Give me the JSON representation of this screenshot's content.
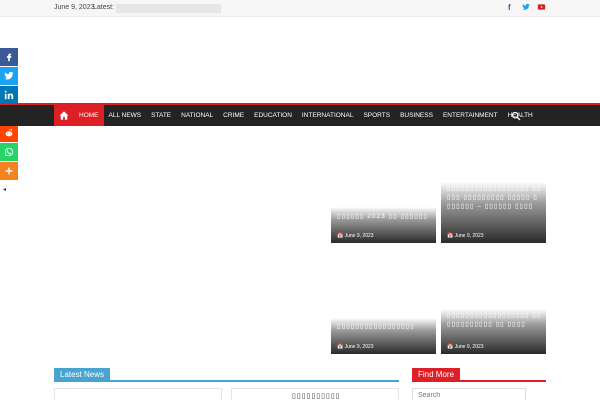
{
  "topbar": {
    "date": "June 9, 2023",
    "latest_label": "Latest:",
    "social": [
      {
        "name": "facebook-icon",
        "glyph": "f",
        "color": "#3b5998"
      },
      {
        "name": "twitter-icon",
        "glyph": "t",
        "color": "#1da1f2"
      },
      {
        "name": "youtube-icon",
        "glyph": "▶",
        "color": "#cd201f"
      }
    ]
  },
  "share": {
    "buttons": [
      {
        "name": "facebook-share-icon",
        "color": "#3b5998"
      },
      {
        "name": "twitter-share-icon",
        "color": "#1da1f2"
      },
      {
        "name": "linkedin-share-icon",
        "color": "#0077b5"
      },
      {
        "name": "pinterest-share-icon",
        "color": "#cb2027"
      },
      {
        "name": "reddit-share-icon",
        "color": "#ff4500"
      },
      {
        "name": "whatsapp-share-icon",
        "color": "#25d366"
      },
      {
        "name": "more-share-icon",
        "color": "#f58220"
      }
    ],
    "hide_label": "◂"
  },
  "nav": {
    "items": [
      "HOME",
      "ALL NEWS",
      "STATE",
      "NATIONAL",
      "CRIME",
      "EDUCATION",
      "INTERNATIONAL",
      "SPORTS",
      "BUSINESS",
      "ENTERTAINMENT",
      "HEALTH"
    ],
    "active_index": 0
  },
  "featured": [
    {
      "title": "▯▯▯▯▯▯ 2023 ▯▯ ▯▯▯▯▯▯",
      "date": "June 9, 2023"
    },
    {
      "title": "▯▯▯▯▯▯▯▯▯▯▯▯▯▯▯▯▯▯ ▯▯▯▯▯ ▯▯▯▯▯▯▯▯▯ ▯▯▯▯▯ ▯▯▯▯▯▯▯ – ▯▯▯▯▯▯ ▯▯▯▯",
      "date": "June 9, 2023"
    },
    {
      "title": "▯▯▯▯▯▯▯▯▯▯▯▯▯▯▯▯▯",
      "date": "June 9, 2023"
    },
    {
      "title": "▯▯▯▯▯▯▯▯▯▯▯▯▯▯▯▯▯▯ ▯▯▯▯▯▯▯▯▯▯▯▯ ▯▯ ▯▯▯▯",
      "date": "June 9, 2023"
    }
  ],
  "widgets": {
    "latest_news": "Latest News",
    "card_title": "▯▯▯▯▯▯▯▯▯▯",
    "find_more": "Find More",
    "search_placeholder": "Search"
  }
}
